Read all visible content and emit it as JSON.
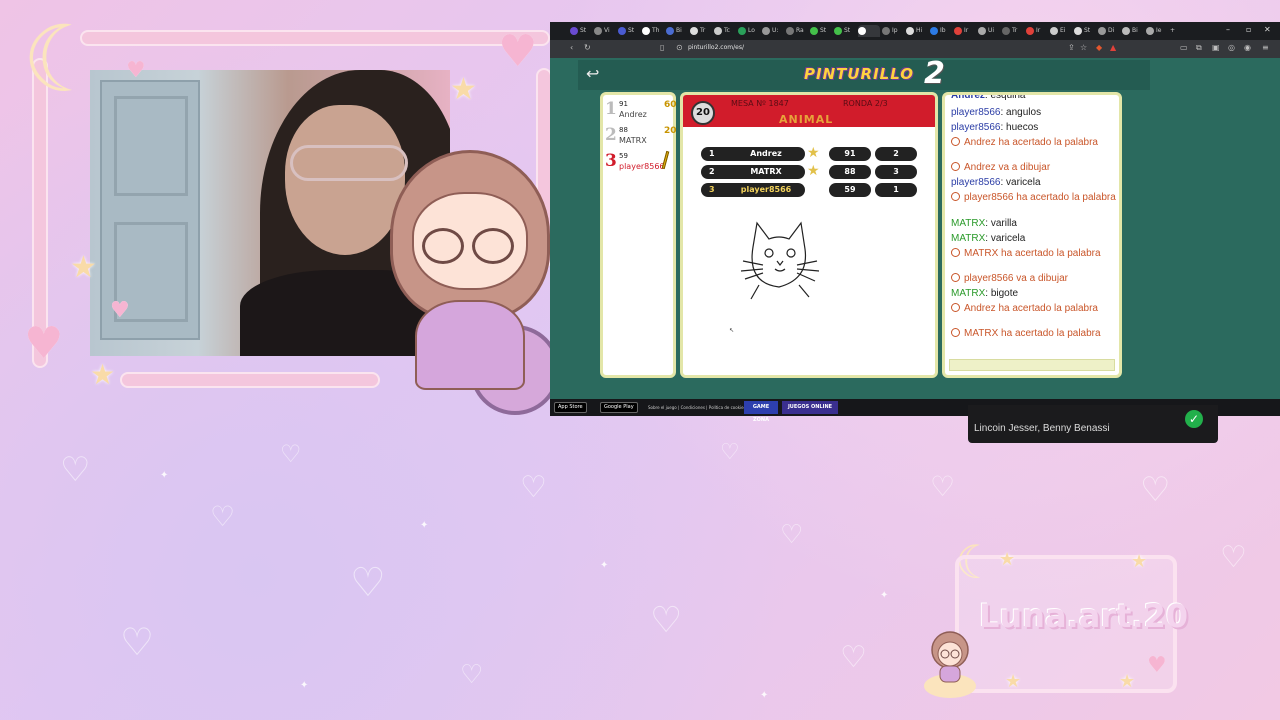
{
  "colors": {
    "accent_red": "#d11c2b",
    "game_bg": "#2b6a5e",
    "chat_user_blue": "#2b3da6",
    "chat_user_green": "#2a9a2a",
    "system_orange": "#c9562a"
  },
  "browser": {
    "url": "pinturillo2.com/es/",
    "tabs": [
      "St",
      "Vi",
      "St",
      "Th",
      "Bi",
      "Tr",
      "Tc",
      "Lo",
      "U:",
      "Ra",
      "St",
      "St",
      "",
      "Ip",
      "Hi",
      "Ib",
      "Ir",
      "Ui",
      "Tr",
      "Ir",
      "Ei",
      "St",
      "Di",
      "Bi",
      "Ie"
    ]
  },
  "game": {
    "logo": "PINTURILLO",
    "logo_number": "2",
    "timer": "20",
    "mesa": "MESA Nº 1847",
    "ronda": "RONDA 2/3",
    "hint": "ANIMAL",
    "players": [
      {
        "rank": "1",
        "score": "91",
        "name": "Andrez",
        "bonus": "60"
      },
      {
        "rank": "2",
        "score": "88",
        "name": "MATRX",
        "bonus": "20"
      },
      {
        "rank": "3",
        "score": "59",
        "name": "player8566",
        "bonus": ""
      }
    ],
    "scoreboard": [
      {
        "rank": "1",
        "name": "Andrez",
        "star": "60",
        "points": "91",
        "round": "2"
      },
      {
        "rank": "2",
        "name": "MATRX",
        "star": "20",
        "points": "88",
        "round": "3"
      },
      {
        "rank": "3",
        "name": "player8566",
        "star": "",
        "points": "59",
        "round": "1"
      }
    ]
  },
  "chat": [
    {
      "user": "Andrez",
      "text": "esquina",
      "type": "user",
      "color": "blue"
    },
    {
      "user": "player8566",
      "text": "angulos",
      "type": "user",
      "color": "blue"
    },
    {
      "user": "player8566",
      "text": "huecos",
      "type": "user",
      "color": "blue"
    },
    {
      "text": "Andrez ha acertado la palabra",
      "type": "system"
    },
    {
      "text": "Andrez va a dibujar",
      "type": "system"
    },
    {
      "user": "player8566",
      "text": "varicela",
      "type": "user",
      "color": "blue"
    },
    {
      "text": "player8566 ha acertado la palabra",
      "type": "system"
    },
    {
      "user": "MATRX",
      "text": "varilla",
      "type": "user",
      "color": "green"
    },
    {
      "user": "MATRX",
      "text": "varicela",
      "type": "user",
      "color": "green"
    },
    {
      "text": "MATRX ha acertado la palabra",
      "type": "system"
    },
    {
      "text": "player8566 va a dibujar",
      "type": "system"
    },
    {
      "user": "MATRX",
      "text": "bigote",
      "type": "user",
      "color": "green"
    },
    {
      "text": "Andrez ha acertado la palabra",
      "type": "system"
    },
    {
      "text": "MATRX ha acertado la palabra",
      "type": "system"
    }
  ],
  "footer": {
    "app_store": "App Store",
    "google_play": "Google Play",
    "links": "Sobre el juego | Condiciones | Política de cookies",
    "banner1": "GAME ZONA",
    "banner2": "JUEGOS ONLINE"
  },
  "now_playing": {
    "artist": "Lincoin Jesser, Benny Benassi"
  },
  "overlay": {
    "channel_name": "Luna.art.20"
  }
}
